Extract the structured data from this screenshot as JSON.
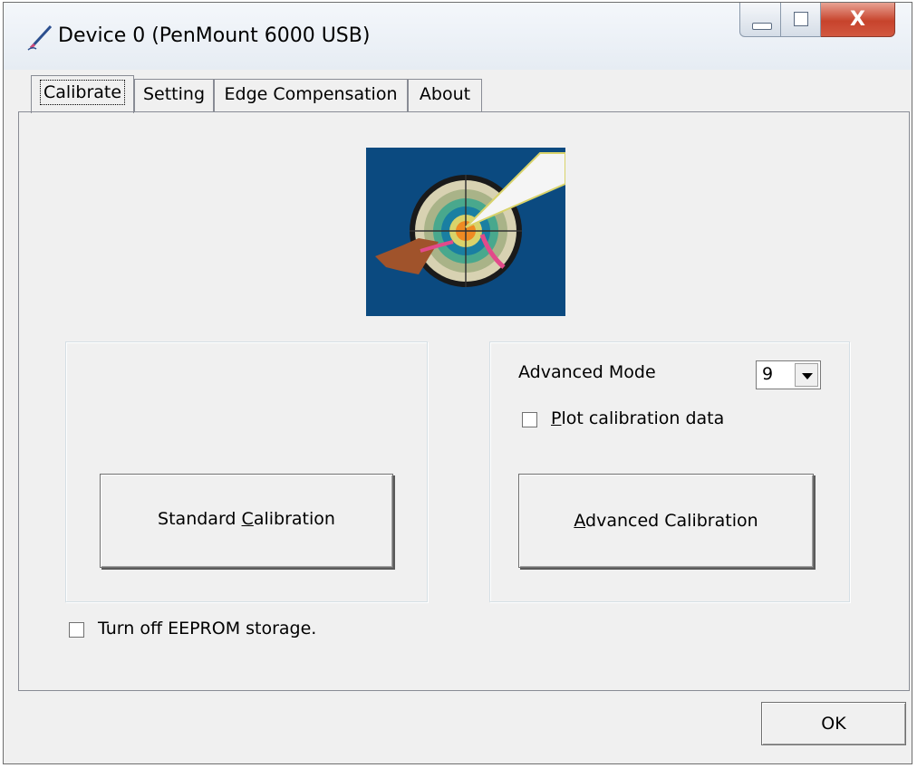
{
  "window": {
    "title": "Device 0 (PenMount 6000 USB)",
    "close_glyph": "X"
  },
  "tabs": [
    {
      "label": "Calibrate",
      "active": true
    },
    {
      "label": "Setting",
      "active": false
    },
    {
      "label": "Edge Compensation",
      "active": false
    },
    {
      "label": "About",
      "active": false
    }
  ],
  "calibrate": {
    "standard_button": {
      "before": "Standard ",
      "underlined": "C",
      "after": "alibration"
    },
    "advanced_mode_label": "Advanced Mode",
    "advanced_mode_value": "9",
    "plot_checkbox": {
      "underlined": "P",
      "after": "lot calibration data",
      "checked": false
    },
    "advanced_button": {
      "underlined": "A",
      "after": "dvanced Calibration"
    },
    "eeprom_checkbox": {
      "label": "Turn off EEPROM storage.",
      "checked": false
    }
  },
  "ok_label": "OK",
  "icons": {
    "app": "pen-icon",
    "logo": "calibration-target-icon"
  },
  "colors": {
    "logo_background": "#0b4a80",
    "close_button": "#c7432c"
  }
}
